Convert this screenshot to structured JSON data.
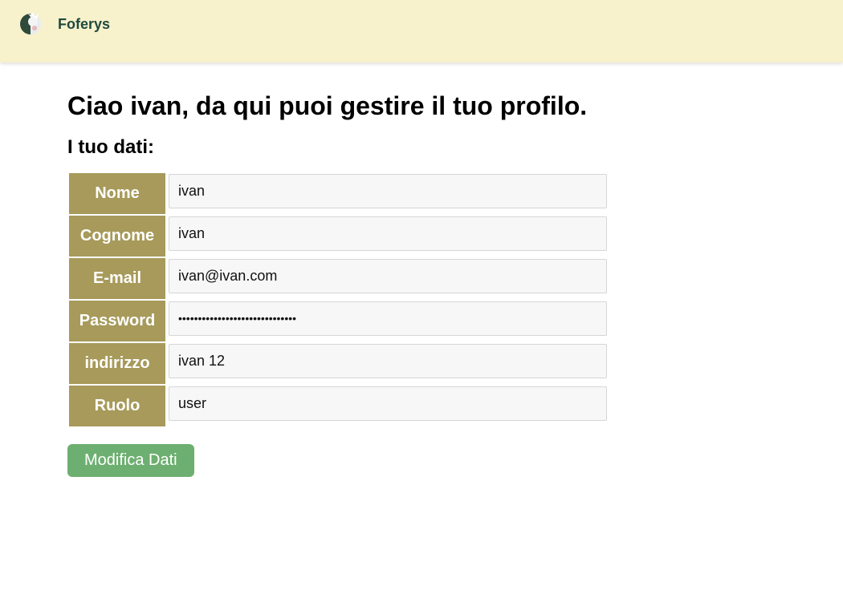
{
  "navbar": {
    "brand": "Foferys",
    "logo_icon": "avatar-logo-icon"
  },
  "page": {
    "title": "Ciao ivan, da qui puoi gestire il tuo profilo.",
    "subtitle": "I tuo dati:"
  },
  "fields": [
    {
      "label": "Nome",
      "value": "ivan"
    },
    {
      "label": "Cognome",
      "value": "ivan"
    },
    {
      "label": "E-mail",
      "value": "ivan@ivan.com"
    },
    {
      "label": "Password",
      "value": "••••••••••••••••••••••••••••••"
    },
    {
      "label": "indirizzo",
      "value": "ivan 12"
    },
    {
      "label": "Ruolo",
      "value": "user"
    }
  ],
  "actions": {
    "edit_label": "Modifica Dati"
  },
  "colors": {
    "navbar_bg": "#f7f1cc",
    "label_bg": "#a79a5a",
    "button_bg": "#6daf70",
    "brand_text": "#1f4a3e"
  }
}
